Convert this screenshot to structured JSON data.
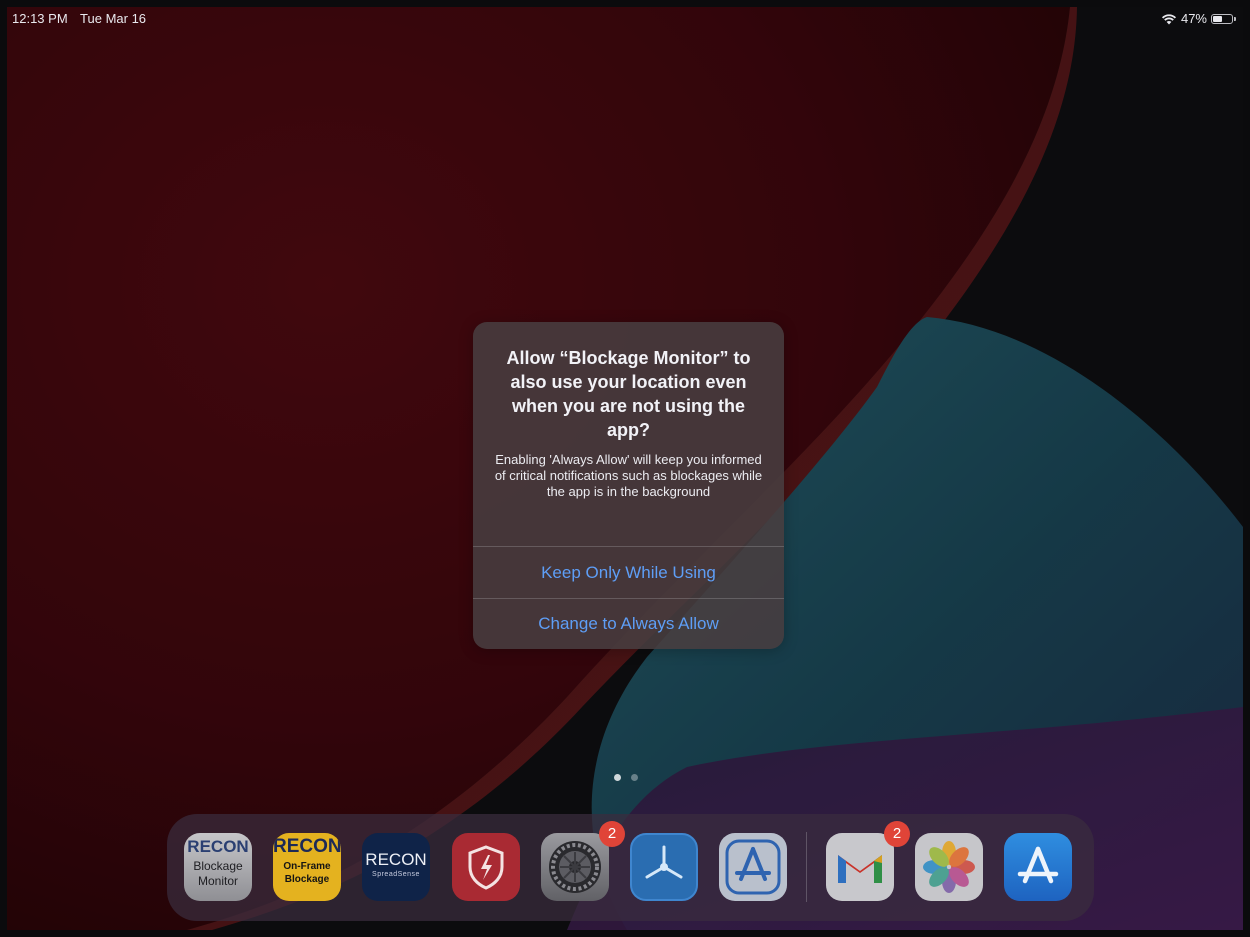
{
  "status_bar": {
    "time": "12:13 PM",
    "date": "Tue Mar 16",
    "battery_percent": "47%",
    "battery_level": 0.47
  },
  "alert": {
    "title": "Allow “Blockage Monitor” to also use your location even when you are not using the app?",
    "message": "Enabling 'Always Allow' will keep you informed of critical notifications such as blockages while the app is in the background",
    "buttons": [
      "Keep Only While Using",
      "Change to Always Allow"
    ]
  },
  "home": {
    "current_page": 1,
    "page_count": 2
  },
  "dock": {
    "app1": {
      "icon": "recon-blockage-monitor-icon",
      "line1": "RECON",
      "line2": "Blockage",
      "line3": "Monitor"
    },
    "app2": {
      "icon": "recon-on-frame-blockage-icon",
      "line1": "RECON",
      "line2": "On-Frame",
      "line3": "Blockage"
    },
    "app3": {
      "icon": "recon-spreadsense-icon",
      "line1": "RECON",
      "line2": "SpreadSense"
    },
    "app4": {
      "icon": "red-shield-app-icon"
    },
    "app5": {
      "icon": "settings-gear-icon",
      "badge": "2"
    },
    "app6": {
      "icon": "propeller-app-icon"
    },
    "app7": {
      "icon": "app-store-outline-icon"
    },
    "app8": {
      "icon": "gmail-icon",
      "badge": "2"
    },
    "app9": {
      "icon": "photos-icon"
    },
    "app10": {
      "icon": "app-store-icon"
    }
  },
  "colors": {
    "alert_button_text": "#5e9ef6",
    "badge": "#e04438"
  }
}
